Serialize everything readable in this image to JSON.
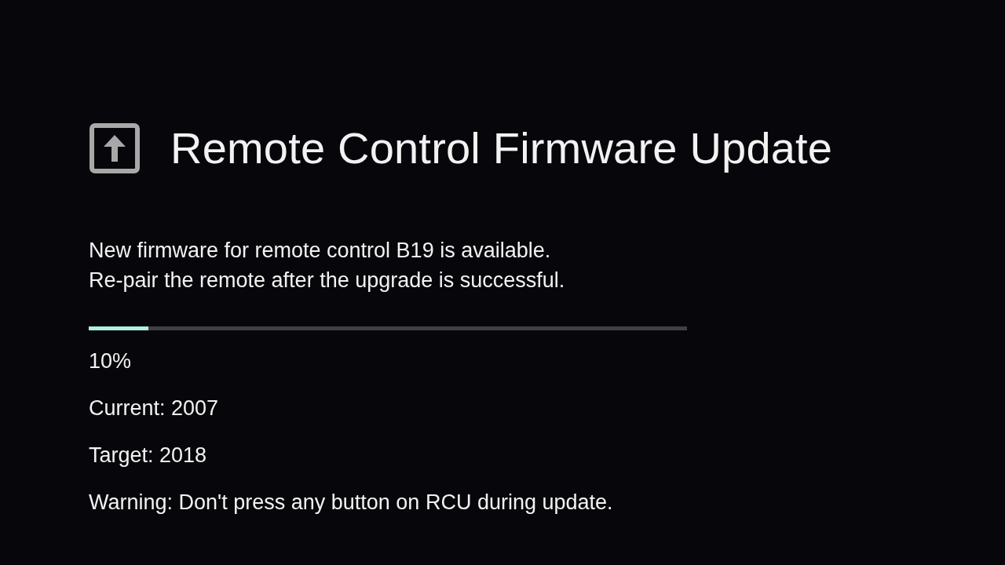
{
  "title": "Remote Control Firmware Update",
  "message": [
    "New firmware for remote control B19 is available.",
    "Re-pair the remote after the upgrade is successful."
  ],
  "progress": {
    "level": 0.1,
    "reading": "10%"
  },
  "details": [
    "Current: 2007",
    "Target: 2018",
    "Warning: Don't press any button on RCU during update."
  ]
}
